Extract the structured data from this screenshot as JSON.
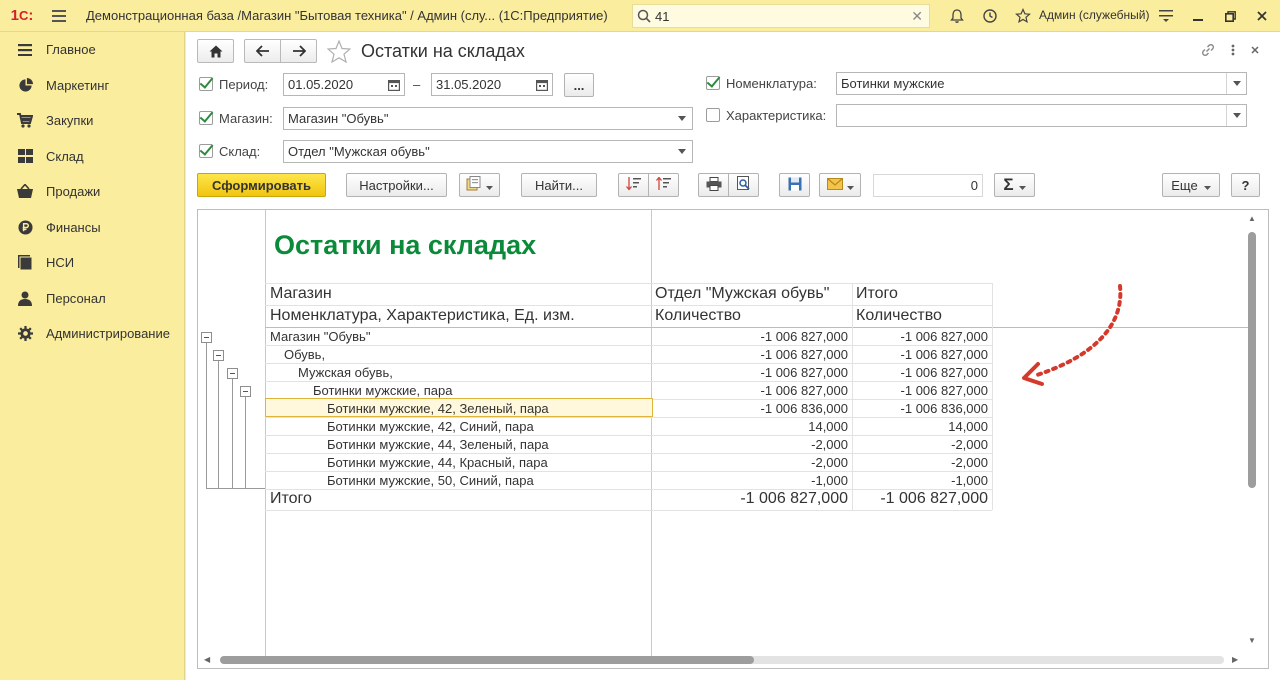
{
  "app": {
    "title": "Демонстрационная база /Магазин \"Бытовая техника\" / Админ (слу...  (1С:Предприятие)",
    "search_value": "41",
    "user": "Админ (служебный)"
  },
  "sidebar": {
    "items": [
      {
        "label": "Главное",
        "icon": "menu-lines-icon"
      },
      {
        "label": "Маркетинг",
        "icon": "pie-chart-icon"
      },
      {
        "label": "Закупки",
        "icon": "cart-icon"
      },
      {
        "label": "Склад",
        "icon": "warehouse-grid-icon"
      },
      {
        "label": "Продажи",
        "icon": "basket-icon"
      },
      {
        "label": "Финансы",
        "icon": "ruble-coin-icon"
      },
      {
        "label": "НСИ",
        "icon": "reference-books-icon"
      },
      {
        "label": "Персонал",
        "icon": "person-icon"
      },
      {
        "label": "Администрирование",
        "icon": "gear-icon"
      }
    ]
  },
  "form": {
    "title": "Остатки на складах",
    "period_label": "Период:",
    "period_from": "01.05.2020",
    "period_dash": "–",
    "period_to": "31.05.2020",
    "period_more": "...",
    "store_label": "Магазин:",
    "store_value": "Магазин \"Обувь\"",
    "warehouse_label": "Склад:",
    "warehouse_value": "Отдел \"Мужская обувь\"",
    "nomenclature_label": "Номенклатура:",
    "nomenclature_value": "Ботинки мужские",
    "characteristic_label": "Характеристика:",
    "characteristic_value": ""
  },
  "toolbar": {
    "generate": "Сформировать",
    "settings": "Настройки...",
    "find": "Найти...",
    "sum_value": "0",
    "more": "Еще",
    "help": "?"
  },
  "report": {
    "title": "Остатки на складах",
    "header": {
      "col1_row1": "Магазин",
      "col1_row2": "Номенклатура, Характеристика, Ед. изм.",
      "col2_row1": "Отдел \"Мужская обувь\"",
      "col2_row2": "Количество",
      "col3_row1": "Итого",
      "col3_row2": "Количество"
    },
    "rows": [
      {
        "name": "Магазин \"Обувь\"",
        "v1": "-1 006 827,000",
        "v2": "-1 006 827,000"
      },
      {
        "name": "Обувь,",
        "v1": "-1 006 827,000",
        "v2": "-1 006 827,000"
      },
      {
        "name": "Мужская обувь,",
        "v1": "-1 006 827,000",
        "v2": "-1 006 827,000"
      },
      {
        "name": "Ботинки мужские, пара",
        "v1": "-1 006 827,000",
        "v2": "-1 006 827,000"
      },
      {
        "name": "Ботинки мужские, 42, Зеленый, пара",
        "v1": "-1 006 836,000",
        "v2": "-1 006 836,000"
      },
      {
        "name": "Ботинки мужские, 42, Синий, пара",
        "v1": "14,000",
        "v2": "14,000"
      },
      {
        "name": "Ботинки мужские, 44, Зеленый, пара",
        "v1": "-2,000",
        "v2": "-2,000"
      },
      {
        "name": "Ботинки мужские, 44, Красный, пара",
        "v1": "-2,000",
        "v2": "-2,000"
      },
      {
        "name": "Ботинки мужские, 50, Синий, пара",
        "v1": "-1,000",
        "v2": "-1,000"
      }
    ],
    "total": {
      "name": "Итого",
      "v1": "-1 006 827,000",
      "v2": "-1 006 827,000"
    }
  },
  "colors": {
    "accent_yellow": "#fbed9e",
    "title_green": "#0b8a39",
    "arrow_red": "#d43a2c"
  }
}
